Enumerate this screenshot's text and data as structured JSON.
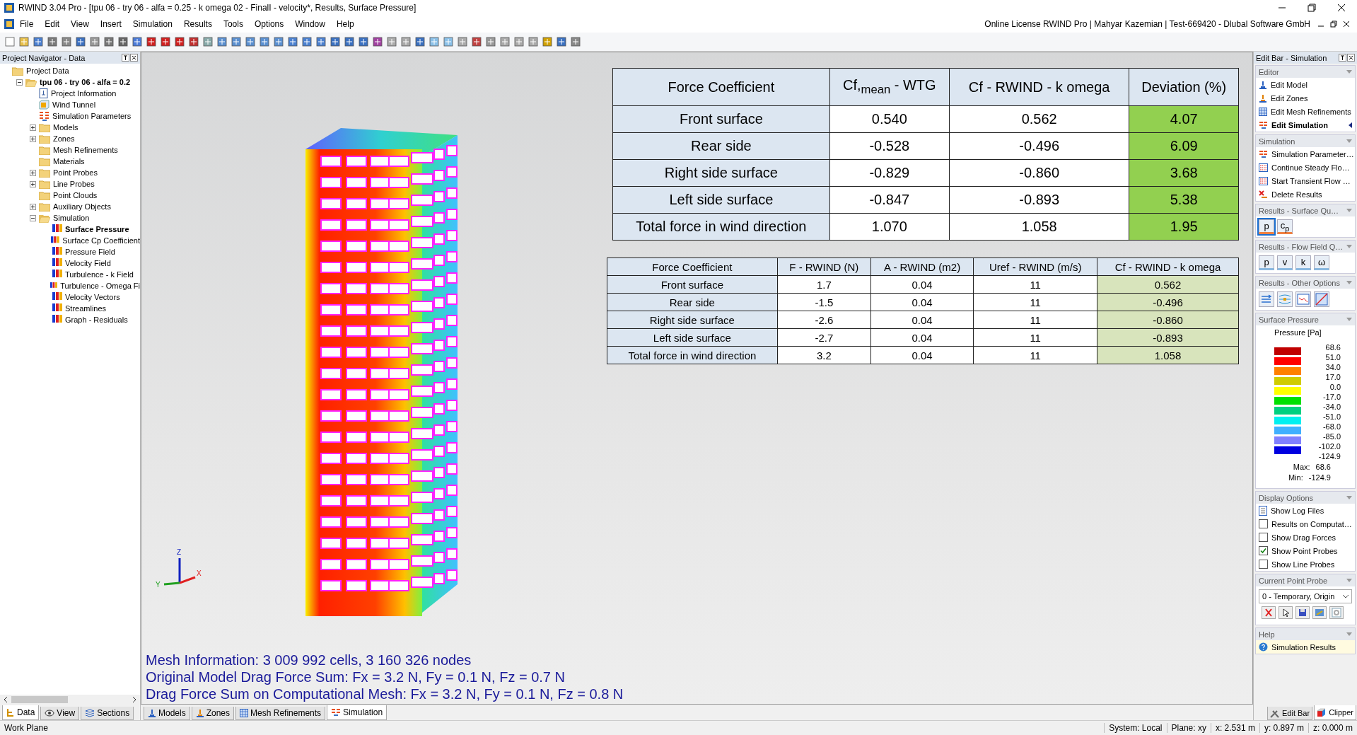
{
  "window": {
    "title": "RWIND 3.04 Pro - [tpu 06 - try 06 - alfa = 0.25 - k omega 02 - FinalI -  velocity*, Results, Surface Pressure]"
  },
  "menu": {
    "items": [
      "File",
      "Edit",
      "View",
      "Insert",
      "Simulation",
      "Results",
      "Tools",
      "Options",
      "Window",
      "Help"
    ],
    "license": "Online License RWIND Pro | Mahyar Kazemian | Test-669420 - Dlubal Software GmbH"
  },
  "navigator": {
    "title": "Project Navigator - Data",
    "tree": [
      {
        "label": "Project Data",
        "kind": "root",
        "children": [
          {
            "label": "tpu 06 - try 06 - alfa = 0.2",
            "kind": "project",
            "expanded": true,
            "children": [
              {
                "label": "Project Information",
                "kind": "info"
              },
              {
                "label": "Wind Tunnel",
                "kind": "tunnel"
              },
              {
                "label": "Simulation Parameters",
                "kind": "parameters"
              },
              {
                "label": "Models",
                "kind": "folder",
                "expanded": false
              },
              {
                "label": "Zones",
                "kind": "folder",
                "expanded": false
              },
              {
                "label": "Mesh Refinements",
                "kind": "folder"
              },
              {
                "label": "Materials",
                "kind": "folder"
              },
              {
                "label": "Point Probes",
                "kind": "folder",
                "expanded": false
              },
              {
                "label": "Line Probes",
                "kind": "folder",
                "expanded": false
              },
              {
                "label": "Point Clouds",
                "kind": "folder"
              },
              {
                "label": "Auxiliary Objects",
                "kind": "folder",
                "expanded": false
              },
              {
                "label": "Simulation",
                "kind": "group",
                "expanded": true,
                "children": [
                  {
                    "label": "Surface Pressure",
                    "kind": "result",
                    "selected": true
                  },
                  {
                    "label": "Surface Cp Coefficient",
                    "kind": "result",
                    "selected": false
                  },
                  {
                    "label": "Pressure Field",
                    "kind": "result",
                    "selected": false
                  },
                  {
                    "label": "Velocity Field",
                    "kind": "result",
                    "selected": false
                  },
                  {
                    "label": "Turbulence - k Field",
                    "kind": "result",
                    "selected": false
                  },
                  {
                    "label": "Turbulence - Omega Fi",
                    "kind": "result",
                    "selected": false
                  },
                  {
                    "label": "Velocity Vectors",
                    "kind": "result",
                    "selected": false
                  },
                  {
                    "label": "Streamlines",
                    "kind": "result",
                    "selected": false
                  },
                  {
                    "label": "Graph - Residuals",
                    "kind": "result",
                    "selected": false
                  }
                ]
              }
            ]
          }
        ]
      }
    ],
    "tabs": [
      {
        "label": "Data",
        "kind": "data",
        "selected": true
      },
      {
        "label": "View",
        "kind": "view",
        "selected": false
      },
      {
        "label": "Sections",
        "kind": "sections",
        "selected": false
      }
    ]
  },
  "viewport": {
    "tables": [
      {
        "columns": [
          {
            "label": "Force Coefficient",
            "highlight": false
          },
          {
            "label": "Cf,$_{mean}$ - WTG",
            "highlight": false
          },
          {
            "label": "Cf - RWIND - k omega",
            "highlight": false
          },
          {
            "label": "Deviation (%)",
            "highlight": true
          }
        ],
        "rows": [
          [
            "Front surface",
            "0.540",
            "0.562",
            "4.07"
          ],
          [
            "Rear side",
            "-0.528",
            "-0.496",
            "6.09"
          ],
          [
            "Right side surface",
            "-0.829",
            "-0.860",
            "3.68"
          ],
          [
            "Left side surface",
            "-0.847",
            "-0.893",
            "5.38"
          ],
          [
            "Total force in wind direction",
            "1.070",
            "1.058",
            "1.95"
          ]
        ]
      },
      {
        "columns": [
          {
            "label": "Force Coefficient",
            "highlight": false
          },
          {
            "label": "F - RWIND (N)",
            "highlight": false
          },
          {
            "label": "A - RWIND (m2)",
            "highlight": false
          },
          {
            "label": "Uref - RWIND (m/s)",
            "highlight": false
          },
          {
            "label": "Cf - RWIND - k omega",
            "highlight": true
          }
        ],
        "rows": [
          [
            "Front surface",
            "1.7",
            "0.04",
            "11",
            "0.562"
          ],
          [
            "Rear side",
            "-1.5",
            "0.04",
            "11",
            "-0.496"
          ],
          [
            "Right side surface",
            "-2.6",
            "0.04",
            "11",
            "-0.860"
          ],
          [
            "Left side surface",
            "-2.7",
            "0.04",
            "11",
            "-0.893"
          ],
          [
            "Total force in wind direction",
            "3.2",
            "0.04",
            "11",
            "1.058"
          ]
        ]
      }
    ],
    "axes": [
      "Z",
      "X",
      "Y"
    ],
    "info": [
      "Mesh Information: 3 009 992 cells, 3 160 326 nodes",
      "Original Model Drag Force Sum: Fx = 3.2 N, Fy = 0.1 N, Fz = 0.7 N",
      "Drag Force Sum on Computational Mesh: Fx = 3.2 N, Fy = 0.1 N, Fz = 0.8 N"
    ],
    "tabs": [
      {
        "label": "Models",
        "kind": "model",
        "selected": false
      },
      {
        "label": "Zones",
        "kind": "zone",
        "selected": false
      },
      {
        "label": "Mesh Refinements",
        "kind": "mesh",
        "selected": false
      },
      {
        "label": "Simulation",
        "kind": "simulation",
        "selected": true
      }
    ]
  },
  "editbar": {
    "title": "Edit Bar - Simulation",
    "sections": [
      {
        "title": "Editor",
        "kind": "links",
        "items": [
          {
            "label": "Edit Model",
            "kind": "model",
            "selected": false
          },
          {
            "label": "Edit Zones",
            "kind": "zone",
            "selected": false
          },
          {
            "label": "Edit Mesh Refinements",
            "kind": "mesh",
            "selected": false
          },
          {
            "label": "Edit Simulation",
            "kind": "simulation",
            "selected": true
          }
        ]
      },
      {
        "title": "Simulation",
        "kind": "links",
        "items": [
          {
            "label": "Simulation Parameter…",
            "kind": "simulation",
            "selected": false
          },
          {
            "label": "Continue Steady Flo…",
            "kind": "run",
            "selected": false
          },
          {
            "label": "Start Transient Flow …",
            "kind": "run",
            "selected": false
          },
          {
            "label": "Delete Results",
            "kind": "delete",
            "selected": false
          }
        ]
      },
      {
        "title": "Results - Surface Qu…",
        "kind": "buttons",
        "buttons": [
          {
            "label": "p",
            "selected": true
          },
          {
            "label": "c$_{p}$",
            "selected": false
          }
        ]
      },
      {
        "title": "Results - Flow Field Q…",
        "kind": "buttons",
        "buttons": [
          {
            "label": "p",
            "selected": false
          },
          {
            "label": "v",
            "selected": false
          },
          {
            "label": "k",
            "selected": false
          },
          {
            "label": "ω",
            "selected": false
          }
        ]
      },
      {
        "title": "Results - Other Options",
        "kind": "icons"
      },
      {
        "title": "Surface Pressure",
        "kind": "legend",
        "legend": {
          "title": "Pressure [Pa]",
          "swatches": [
            {
              "color": "#c00000"
            },
            {
              "color": "#ff0000"
            },
            {
              "color": "#ff8000"
            },
            {
              "color": "#d0cc00"
            },
            {
              "color": "#ffff00"
            },
            {
              "color": "#00e000"
            },
            {
              "color": "#00d080"
            },
            {
              "color": "#00f0f0"
            },
            {
              "color": "#40b0ff"
            },
            {
              "color": "#8080ff"
            },
            {
              "color": "#0000e0"
            }
          ],
          "values": [
            "68.6",
            "51.0",
            "34.0",
            "17.0",
            "0.0",
            "-17.0",
            "-34.0",
            "-51.0",
            "-68.0",
            "-85.0",
            "-102.0",
            "-124.9"
          ],
          "max_label": "Max:",
          "max": "68.6",
          "min_label": "Min:",
          "min": "-124.9"
        }
      },
      {
        "title": "Display Options",
        "kind": "options",
        "items": [
          {
            "label": "Show Log Files",
            "kind": "log"
          },
          {
            "label": "Results on Computat…",
            "kind": "checkbox",
            "checked": false
          },
          {
            "label": "Show Drag Forces",
            "kind": "checkbox",
            "checked": false
          },
          {
            "label": "Show Point Probes",
            "kind": "checkbox",
            "checked": true
          },
          {
            "label": "Show Line Probes",
            "kind": "checkbox",
            "checked": false
          }
        ]
      },
      {
        "title": "Current Point Probe",
        "kind": "probe",
        "value": "0 - Temporary, Origin"
      },
      {
        "title": "Help",
        "kind": "help",
        "items": [
          "Simulation Results"
        ]
      }
    ],
    "tabs": [
      {
        "label": "Edit Bar",
        "kind": "editbar",
        "selected": false
      },
      {
        "label": "Clipper",
        "kind": "clipper",
        "selected": true
      }
    ]
  },
  "status_bar": {
    "left": "Work Plane",
    "cells": [
      "System: Local",
      "Plane: xy",
      "x: 2.531 m",
      "y: 0.897 m",
      "z: 0.000 m"
    ]
  }
}
